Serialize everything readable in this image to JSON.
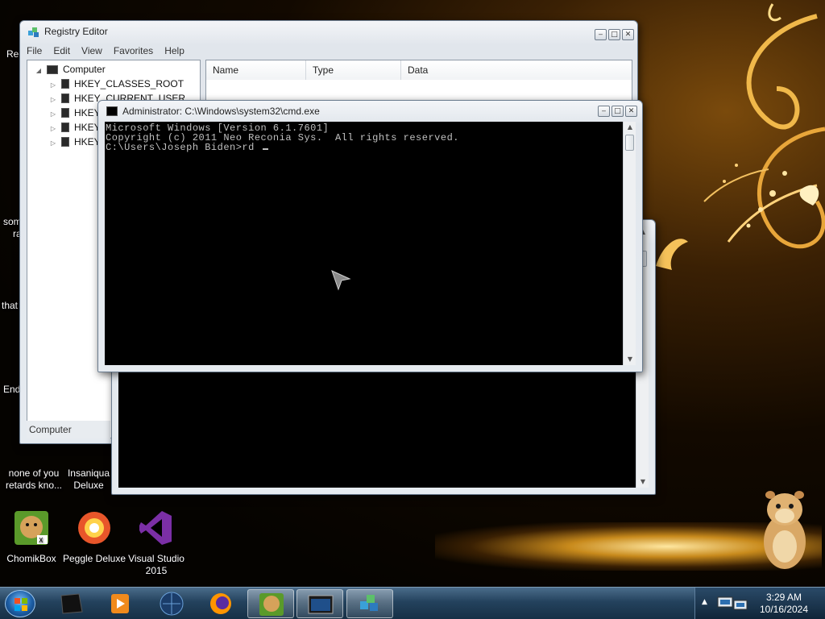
{
  "desktop": {
    "icons": [
      {
        "label": "ChomikBox",
        "icon": "chomikbox-icon"
      },
      {
        "label": "Peggle Deluxe",
        "icon": "peggle-icon"
      },
      {
        "label": "Visual Studio 2015",
        "icon": "visual-studio-icon"
      }
    ],
    "partial_labels": {
      "rec": "Rec",
      "som": "som",
      "ra": "ra",
      "that": "that",
      "end": "End",
      "none_line1": "none of you",
      "none_line2": "retards kno...",
      "insaniqua_line1": "Insaniqua",
      "insaniqua_line2": "Deluxe"
    }
  },
  "regedit": {
    "title": "Registry Editor",
    "menu": [
      "File",
      "Edit",
      "View",
      "Favorites",
      "Help"
    ],
    "tree": {
      "root": "Computer",
      "hives": [
        "HKEY_CLASSES_ROOT",
        "HKEY_CURRENT_USER",
        "HKEY_LOCAL_MACHINE",
        "HKEY_USERS",
        "HKEY_CURRENT_CONFIG"
      ]
    },
    "columns": [
      "Name",
      "Type",
      "Data"
    ],
    "status": "Computer"
  },
  "cmd": {
    "title": "Administrator: C:\\Windows\\system32\\cmd.exe",
    "lines": [
      "Microsoft Windows [Version 6.1.7601]",
      "Copyright (c) 2011 Neo Reconia Sys.  All rights reserved.",
      "",
      "C:\\Users\\Joseph Biden>rd "
    ]
  },
  "taskbar": {
    "items": [
      "cmd-black-icon",
      "media-player-icon",
      "globe-icon",
      "firefox-icon",
      "chomikbox-icon",
      "cmd-window-icon",
      "regedit-icon"
    ],
    "clock_time": "3:29 AM",
    "clock_date": "10/16/2024"
  },
  "colors": {
    "console_bg": "#000000",
    "console_text": "#c0c0c0",
    "taskbar": "#24425d"
  }
}
